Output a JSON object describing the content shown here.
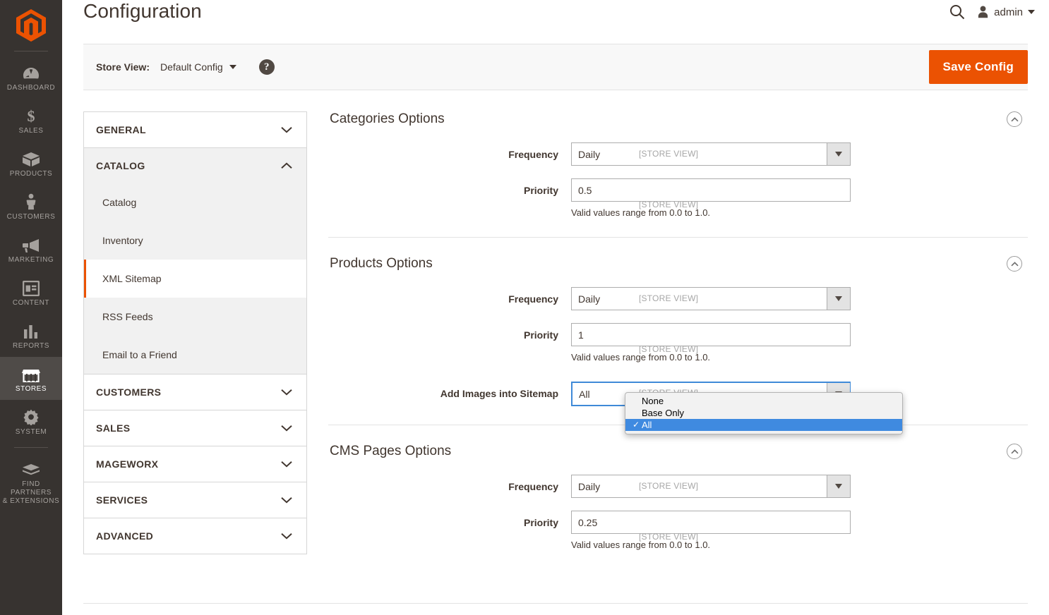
{
  "admin_nav": {
    "logo": "magento-logo",
    "items": [
      {
        "label": "Dashboard",
        "icon": "dashboard-icon",
        "active": false
      },
      {
        "label": "Sales",
        "icon": "dollar-icon",
        "active": false
      },
      {
        "label": "Products",
        "icon": "box-icon",
        "active": false
      },
      {
        "label": "Customers",
        "icon": "person-icon",
        "active": false
      },
      {
        "label": "Marketing",
        "icon": "megaphone-icon",
        "active": false
      },
      {
        "label": "Content",
        "icon": "layout-icon",
        "active": false
      },
      {
        "label": "Reports",
        "icon": "bar-chart-icon",
        "active": false
      },
      {
        "label": "Stores",
        "icon": "storefront-icon",
        "active": true
      },
      {
        "label": "System",
        "icon": "gear-icon",
        "active": false
      },
      {
        "label": "Find Partners\n& Extensions",
        "icon": "puzzle-icon",
        "active": false
      }
    ]
  },
  "header": {
    "title": "Configuration",
    "search_icon": "search-icon",
    "avatar_icon": "user-avatar-icon",
    "user_name": "admin"
  },
  "store_bar": {
    "label": "Store View:",
    "selected": "Default Config",
    "help_icon": "question-mark-icon",
    "save_label": "Save Config",
    "accent_color": "#eb5202"
  },
  "config_menu": {
    "sections": [
      {
        "title": "General",
        "open": false,
        "items": []
      },
      {
        "title": "Catalog",
        "open": true,
        "items": [
          {
            "label": "Catalog",
            "active": false
          },
          {
            "label": "Inventory",
            "active": false
          },
          {
            "label": "XML Sitemap",
            "active": true
          },
          {
            "label": "RSS Feeds",
            "active": false
          },
          {
            "label": "Email to a Friend",
            "active": false
          }
        ]
      },
      {
        "title": "Customers",
        "open": false,
        "items": []
      },
      {
        "title": "Sales",
        "open": false,
        "items": []
      },
      {
        "title": "Mageworx",
        "open": false,
        "items": []
      },
      {
        "title": "Services",
        "open": false,
        "items": []
      },
      {
        "title": "Advanced",
        "open": false,
        "items": []
      }
    ]
  },
  "settings": {
    "scope_tag": "[STORE VIEW]",
    "priority_note": "Valid values range from 0.0 to 1.0.",
    "categories": {
      "title": "Categories Options",
      "frequency_label": "Frequency",
      "frequency_value": "Daily",
      "priority_label": "Priority",
      "priority_value": "0.5"
    },
    "products": {
      "title": "Products Options",
      "frequency_label": "Frequency",
      "frequency_value": "Daily",
      "priority_label": "Priority",
      "priority_value": "1",
      "images_label": "Add Images into Sitemap",
      "images_value": "All"
    },
    "cms": {
      "title": "CMS Pages Options",
      "frequency_label": "Frequency",
      "frequency_value": "Daily",
      "priority_label": "Priority",
      "priority_value": "0.25"
    }
  },
  "open_dropdown": {
    "field": "Add Images into Sitemap",
    "options": [
      {
        "label": "None",
        "selected": false
      },
      {
        "label": "Base Only",
        "selected": false
      },
      {
        "label": "All",
        "selected": true
      }
    ],
    "checkmark": "✓",
    "highlight_color": "#3f8ae0"
  }
}
